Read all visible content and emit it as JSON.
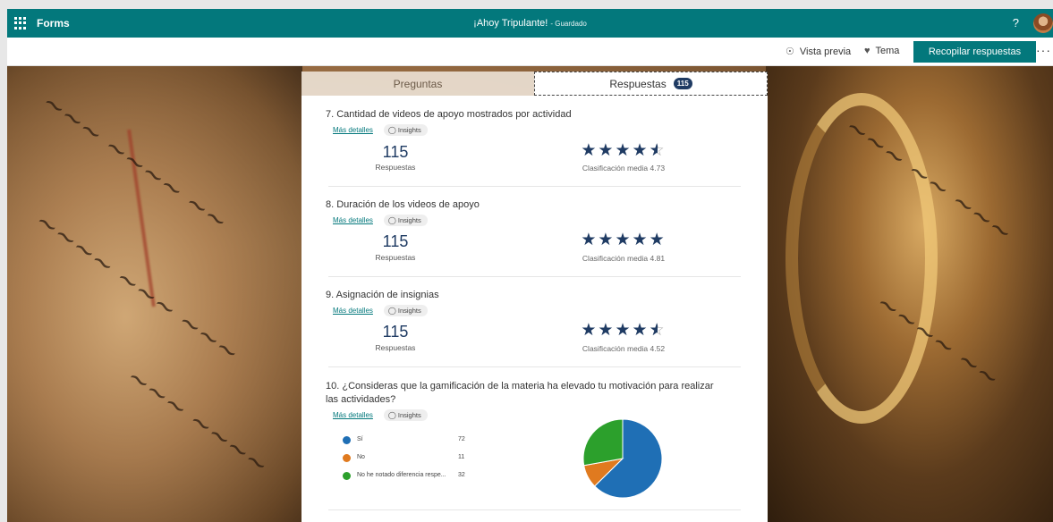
{
  "app": {
    "name": "Forms",
    "title": "¡Ahoy Tripulante!",
    "save_status": "- Guardado",
    "help": "?"
  },
  "command_bar": {
    "preview": "Vista previa",
    "theme": "Tema",
    "collect": "Recopilar respuestas",
    "more": "···"
  },
  "tabs": {
    "questions": "Preguntas",
    "responses": "Respuestas",
    "responses_count": "115"
  },
  "labels": {
    "more_details": "Más detalles",
    "insights": "Insights",
    "responses": "Respuestas"
  },
  "questions": [
    {
      "title": "7.  Cantidad de videos de apoyo mostrados por actividad",
      "count": "115",
      "average_text": "Clasificación media 4.73",
      "rating": 4.73
    },
    {
      "title": "8.  Duración de los videos de apoyo",
      "count": "115",
      "average_text": "Clasificación media 4.81",
      "rating": 4.81
    },
    {
      "title": "9.  Asignación de insignias",
      "count": "115",
      "average_text": "Clasificación media 4.52",
      "rating": 4.52
    },
    {
      "title": "10.  ¿Consideras que la gamificación de la materia ha elevado tu motivación para realizar las actividades?"
    }
  ],
  "chart_data": {
    "type": "pie",
    "categories": [
      "Sí",
      "No",
      "No he notado diferencia respe..."
    ],
    "values": [
      72,
      11,
      32
    ],
    "colors": [
      "#1f6fb5",
      "#e07a1f",
      "#2ca02c"
    ]
  }
}
